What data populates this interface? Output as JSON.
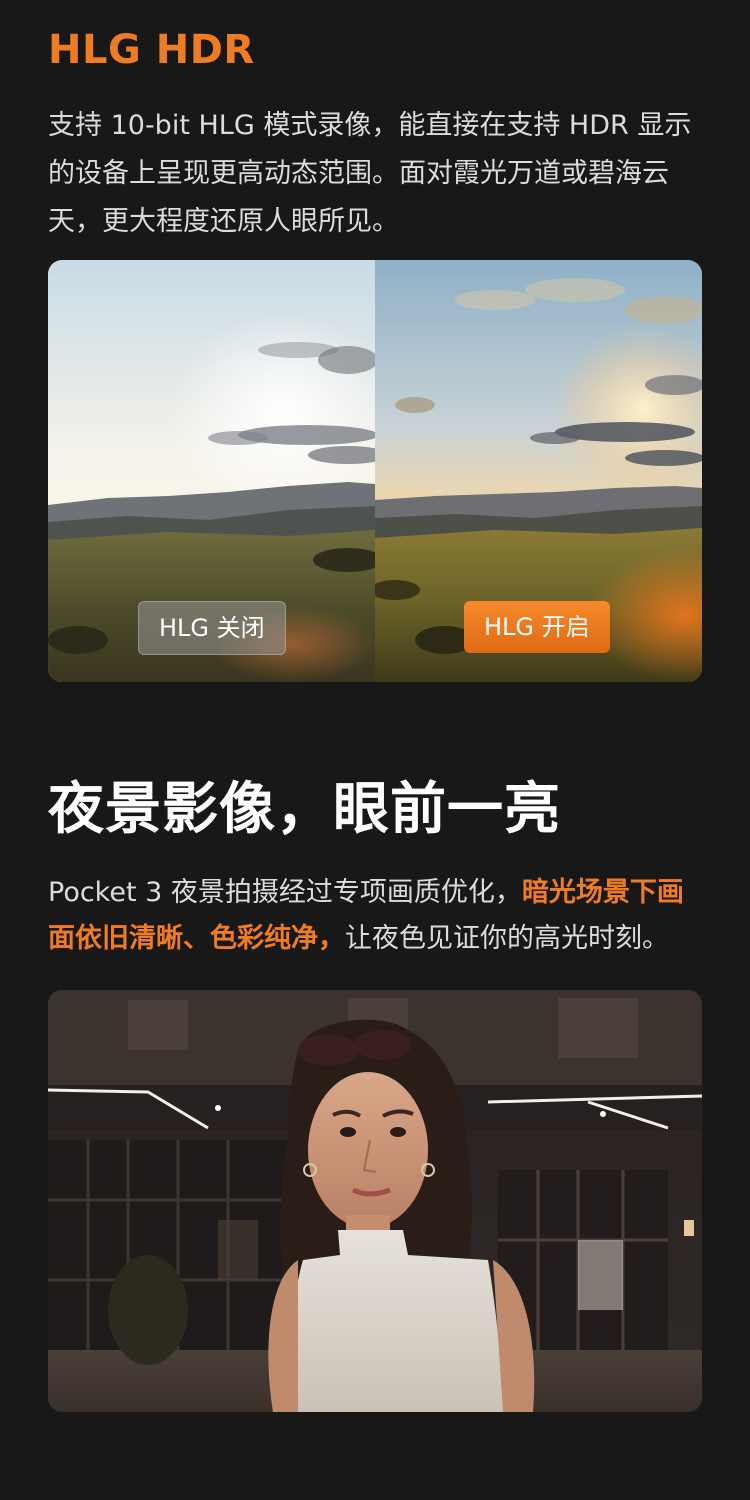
{
  "hlg": {
    "title": "HLG HDR",
    "description": "支持 10-bit HLG 模式录像，能直接在支持 HDR 显示的设备上呈现更高动态范围。面对霞光万道或碧海云天，更大程度还原人眼所见。",
    "label_off": "HLG 关闭",
    "label_on": "HLG 开启"
  },
  "night": {
    "title": "夜景影像，眼前一亮",
    "desc_part1": "Pocket 3 夜景拍摄经过专项画质优化，",
    "desc_highlight": "暗光场景下画面依旧清晰、色彩纯净，",
    "desc_part2": "让夜色见证你的高光时刻。"
  },
  "colors": {
    "accent": "#f07c22",
    "background": "#181818"
  }
}
